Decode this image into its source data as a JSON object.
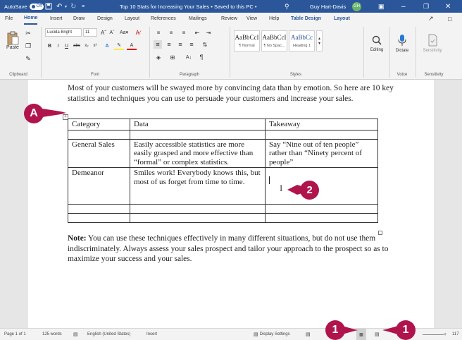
{
  "titlebar": {
    "autosave_label": "AutoSave",
    "autosave_state": "Off",
    "doc_title": "Top 10 Stats for Increasing Your Sales • Saved to this PC •",
    "user_name": "Guy Hart-Davis",
    "user_initials": "GH"
  },
  "menu": {
    "items": [
      "File",
      "Home",
      "Insert",
      "Draw",
      "Design",
      "Layout",
      "References",
      "Mailings",
      "Review",
      "View",
      "Help",
      "Table Design",
      "Layout"
    ]
  },
  "ribbon": {
    "paste_label": "Paste",
    "clipboard_label": "Clipboard",
    "font_name": "Lucida Bright",
    "font_size": "11",
    "font_label": "Font",
    "paragraph_label": "Paragraph",
    "styles": [
      {
        "preview": "AaBbCcI",
        "name": "¶ Normal"
      },
      {
        "preview": "AaBbCcI",
        "name": "¶ No Spac..."
      },
      {
        "preview": "AaBbCc",
        "name": "Heading 1"
      }
    ],
    "styles_label": "Styles",
    "editing_label": "Editing",
    "dictate_label": "Dictate",
    "voice_label": "Voice",
    "sensitivity_label": "Sensitivity",
    "sensitivity_group_label": "Sensitivity"
  },
  "document": {
    "intro": "Most of your customers will be swayed more by convincing data than by emotion. So here are 10 key statistics and techniques you can use to persuade your customers and increase your sales.",
    "table": {
      "headers": [
        "Category",
        "Data",
        "Takeaway"
      ],
      "rows": [
        [
          "General Sales",
          "Easily accessible statistics are more easily grasped and more effective than “formal” or complex statistics.",
          "Say “Nine out of ten people” rather than “Ninety percent of people”"
        ],
        [
          "Demeanor",
          "Smiles work! Everybody knows this, but most of us forget from time to time.",
          ""
        ]
      ]
    },
    "note_label": "Note:",
    "note_text": " You can use these techniques effectively in many different situations, but do not use them indiscriminately. Always assess your sales prospect and tailor your approach to the prospect so as to maximize your success and your sales."
  },
  "callouts": {
    "a": "A",
    "two": "2",
    "one": "1"
  },
  "statusbar": {
    "page": "Page 1 of 1",
    "words": "125 words",
    "language": "English (United States)",
    "mode": "Insert",
    "display_settings": "Display Settings",
    "zoom_partial": "117"
  },
  "colors": {
    "accent": "#2b579a",
    "callout": "#b0144c"
  }
}
